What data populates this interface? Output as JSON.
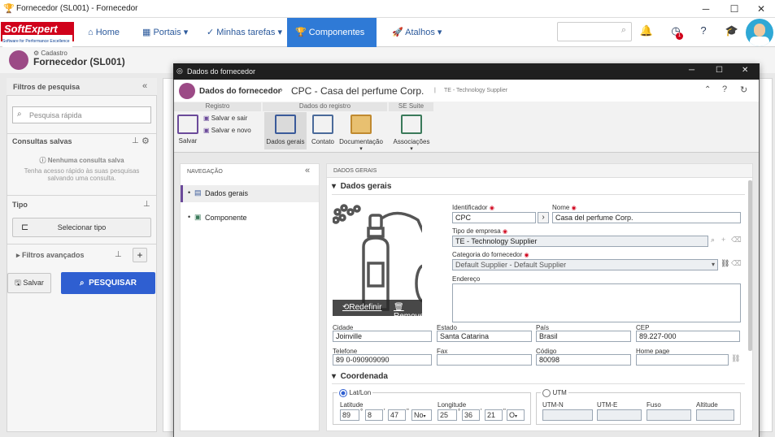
{
  "window": {
    "title": "Fornecedor (SL001) - Fornecedor",
    "minimize": "─",
    "maximize": "☐",
    "close": "✕"
  },
  "brand": {
    "logo": "SoftExpert",
    "tagline": "Software for Performance Excellence"
  },
  "nav": {
    "items": [
      "Home",
      "Portais",
      "Minhas tarefas",
      "Componentes",
      "Atalhos"
    ],
    "active": "Componentes",
    "badge": "1"
  },
  "page": {
    "breadcrumb": "Cadastro",
    "title": "Fornecedor (SL001)"
  },
  "left_panel": {
    "title": "Filtros de pesquisa",
    "quick_search_placeholder": "Pesquisa rápida",
    "saved_queries": "Consultas salvas",
    "no_query": "Nenhuma consulta salva",
    "no_query_hint1": "Tenha acesso rápido às suas pesquisas",
    "no_query_hint2": "salvando uma consulta.",
    "type_label": "Tipo",
    "select_type": "Selecionar tipo",
    "advanced_filters": "Filtros avançados",
    "save_btn": "Salvar",
    "search_btn": "PESQUISAR"
  },
  "dialog": {
    "title": "Dados do fornecedor",
    "header_section": "Dados do fornecedor",
    "header_record": "CPC - Casa del perfume Corp.",
    "header_sub": "TE - Technology Supplier",
    "ribbon": {
      "groups": [
        "Registro",
        "Dados do registro",
        "SE Suite"
      ],
      "save": "Salvar",
      "save_exit": "Salvar e sair",
      "save_new": "Salvar e novo",
      "general": "Dados gerais",
      "contact": "Contato",
      "documentation": "Documentação",
      "associations": "Associações"
    },
    "navigation": {
      "title": "NAVEGAÇÃO",
      "items": [
        "Dados gerais",
        "Componente"
      ]
    },
    "form": {
      "panel_title": "DADOS GERAIS",
      "section": "Dados gerais",
      "image_actions": {
        "reset": "Redefinir",
        "remove": "Remover"
      },
      "identifier_label": "Identificador",
      "identifier": "CPC",
      "name_label": "Nome",
      "name": "Casa del perfume Corp.",
      "company_type_label": "Tipo de empresa",
      "company_type": "TE - Technology Supplier",
      "category_label": "Categoria do fornecedor",
      "category": "Default Supplier - Default Supplier",
      "address_label": "Endereço",
      "address": "",
      "city_label": "Cidade",
      "city": "Joinville",
      "state_label": "Estado",
      "state": "Santa Catarina",
      "country_label": "País",
      "country": "Brasil",
      "zip_label": "CEP",
      "zip": "89.227-000",
      "phone_label": "Telefone",
      "phone": "89 0-090909090",
      "fax_label": "Fax",
      "fax": "",
      "code_label": "Código",
      "code": "80098",
      "homepage_label": "Home page",
      "homepage": "",
      "coord_section": "Coordenada",
      "latlon": "Lat/Lon",
      "utm": "UTM",
      "latitude_label": "Latitude",
      "longitude_label": "Longitude",
      "lat": {
        "deg": "89",
        "min": "8",
        "sec": "47",
        "dir": "No"
      },
      "lon": {
        "deg": "25",
        "min": "36",
        "sec": "21",
        "dir": "O"
      },
      "utm_n": "UTM-N",
      "utm_e": "UTM-E",
      "zone": "Fuso",
      "altitude": "Altitude"
    }
  },
  "colors": {
    "accent": "#2f7ad6",
    "brand": "#d0021b",
    "primary_button": "#2f5fd1",
    "record_icon": "#9c4a86"
  }
}
